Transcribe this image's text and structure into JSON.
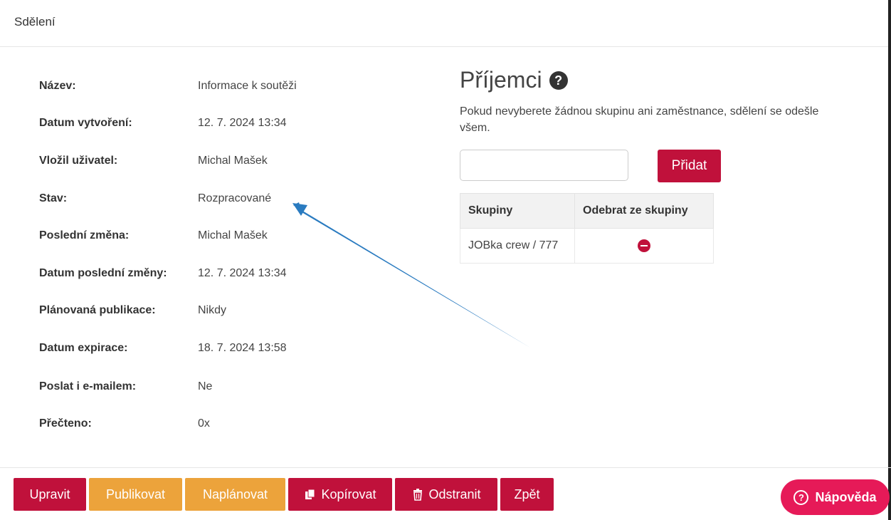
{
  "header": {
    "title": "Sdělení"
  },
  "details": [
    {
      "label": "Název:",
      "value": "Informace k soutěži"
    },
    {
      "label": "Datum vytvoření:",
      "value": "12. 7. 2024 13:34"
    },
    {
      "label": "Vložil uživatel:",
      "value": "Michal Mašek"
    },
    {
      "label": "Stav:",
      "value": "Rozpracované"
    },
    {
      "label": "Poslední změna:",
      "value": "Michal Mašek"
    },
    {
      "label": "Datum poslední změny:",
      "value": "12. 7. 2024 13:34"
    },
    {
      "label": "Plánovaná publikace:",
      "value": "Nikdy"
    },
    {
      "label": "Datum expirace:",
      "value": "18. 7. 2024 13:58"
    },
    {
      "label": "Poslat i e-mailem:",
      "value": "Ne"
    },
    {
      "label": "Přečteno:",
      "value": "0x"
    }
  ],
  "recipients": {
    "title": "Příjemci",
    "help_glyph": "?",
    "note": "Pokud nevyberete žádnou skupinu ani zaměstnance, sdělení se odešle všem.",
    "input_value": "",
    "add_label": "Přidat",
    "table": {
      "headers": [
        "Skupiny",
        "Odebrat ze skupiny"
      ],
      "rows": [
        {
          "group": "JOBka crew / 777"
        }
      ]
    }
  },
  "footer": {
    "edit_label": "Upravit",
    "publish_label": "Publikovat",
    "schedule_label": "Naplánovat",
    "copy_label": "Kopírovat",
    "delete_label": "Odstranit",
    "back_label": "Zpět",
    "help_label": "Nápověda",
    "help_glyph": "?"
  },
  "colors": {
    "primary_red": "#c0113b",
    "orange": "#eca33b",
    "help_pink": "#e61a58",
    "annotation_arrow": "#2a7bc0"
  },
  "icons": {
    "recipients_help": "question-circle-icon",
    "remove_row": "minus-circle-icon",
    "copy": "copy-icon",
    "delete": "trash-icon",
    "help": "question-circle-icon"
  }
}
